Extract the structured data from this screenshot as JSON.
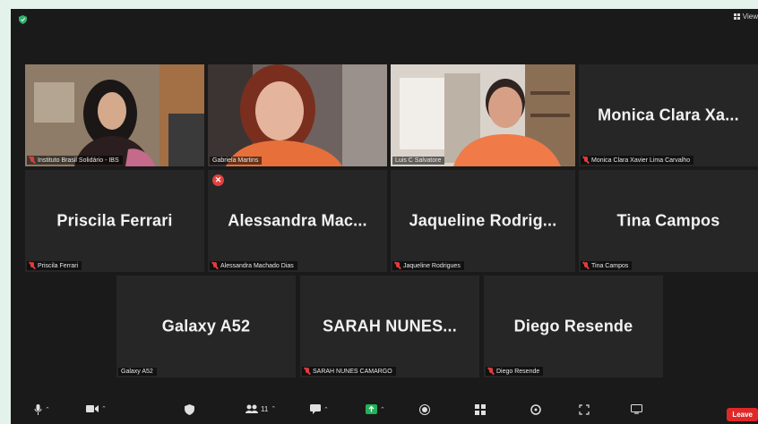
{
  "top": {
    "view_label": "View"
  },
  "tiles": [
    {
      "name": "Instituto Brasil Solidário - IBS",
      "big": "",
      "video": true,
      "muted": true
    },
    {
      "name": "Gabriela Martins",
      "big": "",
      "video": true,
      "muted": false
    },
    {
      "name": "Luis C Salvatore",
      "big": "",
      "video": true,
      "muted": false,
      "active": true
    },
    {
      "name": "Monica Clara Xavier Lima Carvalho",
      "big": "Monica Clara Xa...",
      "muted": true
    },
    {
      "name": "Priscila Ferrari",
      "big": "Priscila Ferrari",
      "muted": true
    },
    {
      "name": "Alessandra Machado Dias",
      "big": "Alessandra  Mac...",
      "muted": true
    },
    {
      "name": "Jaqueline Rodrigues",
      "big": "Jaqueline  Rodrig...",
      "muted": true
    },
    {
      "name": "Tina Campos",
      "big": "Tina Campos",
      "muted": true
    },
    {
      "name": "Galaxy A52",
      "big": "Galaxy A52",
      "muted": false
    },
    {
      "name": "SARAH NUNES CAMARGO",
      "big": "SARAH  NUNES...",
      "muted": true
    },
    {
      "name": "Diego Resende",
      "big": "Diego Resende",
      "muted": true
    }
  ],
  "toolbar": {
    "participants_count": "11",
    "leave_label": "Leave"
  },
  "icons": {
    "shield": "shield-icon",
    "mute_indicator": "mic-muted-icon",
    "video_off_indicator": "x-circle-icon"
  },
  "colors": {
    "active_speaker": "#b7e24a",
    "leave": "#e02828",
    "security_shield": "#2fb36b"
  }
}
